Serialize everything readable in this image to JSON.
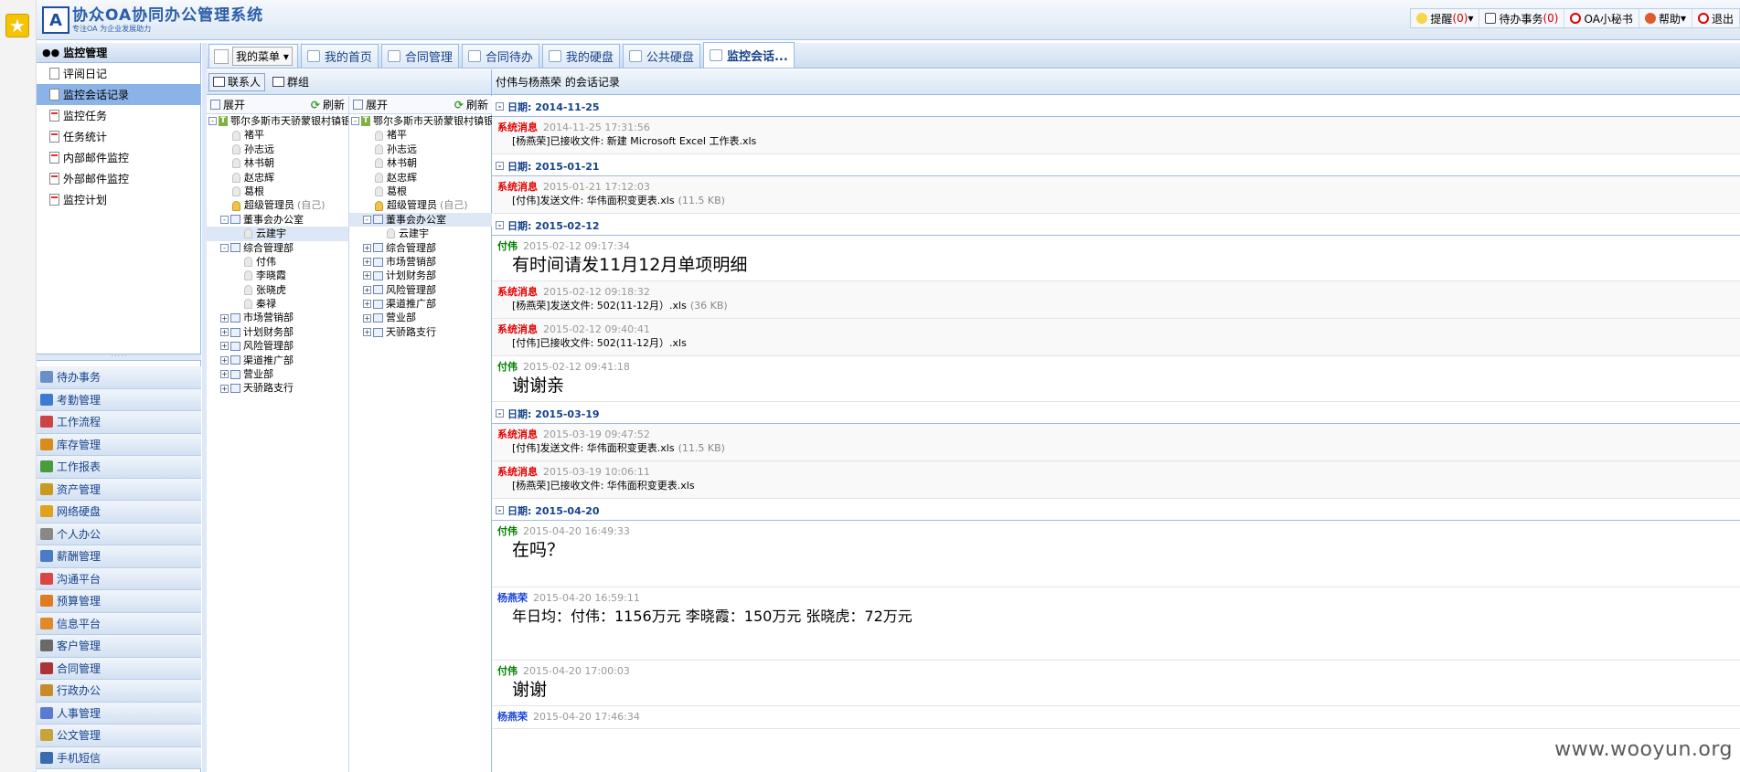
{
  "app": {
    "title": "协众OA协同办公管理系统",
    "slogan": "专注OA 为企业发展助力"
  },
  "topbar": {
    "items": [
      {
        "label": "提醒",
        "count": "(0)",
        "icon": "bulb-icon"
      },
      {
        "label": "待办事务",
        "count": "(0)",
        "icon": "todo-icon"
      },
      {
        "label": "OA小秘书",
        "icon": "clock-icon"
      },
      {
        "label": "帮助",
        "icon": "help-icon"
      },
      {
        "label": "退出",
        "icon": "power-icon"
      }
    ]
  },
  "sidebar": {
    "header": "监控管理",
    "items": [
      {
        "label": "评阅日记",
        "active": false
      },
      {
        "label": "监控会话记录",
        "active": true
      },
      {
        "label": "监控任务",
        "active": false
      },
      {
        "label": "任务统计",
        "active": false
      },
      {
        "label": "内部邮件监控",
        "active": false
      },
      {
        "label": "外部邮件监控",
        "active": false
      },
      {
        "label": "监控计划",
        "active": false
      }
    ],
    "modules": [
      "待办事务",
      "考勤管理",
      "工作流程",
      "库存管理",
      "工作报表",
      "资产管理",
      "网络硬盘",
      "个人办公",
      "薪酬管理",
      "沟通平台",
      "预算管理",
      "信息平台",
      "客户管理",
      "合同管理",
      "行政办公",
      "人事管理",
      "公文管理",
      "手机短信"
    ]
  },
  "tabs": {
    "menu_label": "我的菜单",
    "items": [
      {
        "label": "我的首页",
        "active": false
      },
      {
        "label": "合同管理",
        "active": false
      },
      {
        "label": "合同待办",
        "active": false
      },
      {
        "label": "我的硬盘",
        "active": false
      },
      {
        "label": "公共硬盘",
        "active": false
      },
      {
        "label": "监控会话...",
        "active": true
      }
    ]
  },
  "contacts": {
    "toolbar": {
      "contacts": "联系人",
      "groups": "群组"
    },
    "expand": "展开",
    "refresh": "刷新",
    "tree_left": [
      {
        "type": "root",
        "label": "鄂尔多斯市天骄蒙银村镇银行",
        "exp": "-",
        "indent": 0
      },
      {
        "type": "user",
        "label": "褚平",
        "indent": 2
      },
      {
        "type": "user",
        "label": "孙志远",
        "indent": 2
      },
      {
        "type": "user",
        "label": "林书朝",
        "indent": 2
      },
      {
        "type": "user",
        "label": "赵忠辉",
        "indent": 2
      },
      {
        "type": "user",
        "label": "葛根",
        "indent": 2
      },
      {
        "type": "admin",
        "label": "超级管理员",
        "note": "(自己)",
        "indent": 2
      },
      {
        "type": "dept",
        "label": "董事会办公室",
        "exp": "-",
        "indent": 1
      },
      {
        "type": "user",
        "label": "云建宇",
        "indent": 3,
        "sel": true
      },
      {
        "type": "dept",
        "label": "综合管理部",
        "exp": "-",
        "indent": 1
      },
      {
        "type": "user",
        "label": "付伟",
        "indent": 3
      },
      {
        "type": "user",
        "label": "李晓霞",
        "indent": 3
      },
      {
        "type": "user",
        "label": "张晓虎",
        "indent": 3
      },
      {
        "type": "user",
        "label": "秦禄",
        "indent": 3
      },
      {
        "type": "dept",
        "label": "市场营销部",
        "exp": "+",
        "indent": 1
      },
      {
        "type": "dept",
        "label": "计划财务部",
        "exp": "+",
        "indent": 1
      },
      {
        "type": "dept",
        "label": "风险管理部",
        "exp": "+",
        "indent": 1
      },
      {
        "type": "dept",
        "label": "渠道推广部",
        "exp": "+",
        "indent": 1
      },
      {
        "type": "dept",
        "label": "营业部",
        "exp": "+",
        "indent": 1
      },
      {
        "type": "dept",
        "label": "天骄路支行",
        "exp": "+",
        "indent": 1
      }
    ],
    "tree_right": [
      {
        "type": "root",
        "label": "鄂尔多斯市天骄蒙银村镇银行股",
        "exp": "-",
        "indent": 0
      },
      {
        "type": "user",
        "label": "褚平",
        "indent": 2
      },
      {
        "type": "user",
        "label": "孙志远",
        "indent": 2
      },
      {
        "type": "user",
        "label": "林书朝",
        "indent": 2
      },
      {
        "type": "user",
        "label": "赵忠辉",
        "indent": 2
      },
      {
        "type": "user",
        "label": "葛根",
        "indent": 2
      },
      {
        "type": "admin",
        "label": "超级管理员",
        "note": "(自己)",
        "indent": 2
      },
      {
        "type": "dept",
        "label": "董事会办公室",
        "exp": "-",
        "indent": 1,
        "sel": true
      },
      {
        "type": "user",
        "label": "云建宇",
        "indent": 3
      },
      {
        "type": "dept",
        "label": "综合管理部",
        "exp": "+",
        "indent": 1
      },
      {
        "type": "dept",
        "label": "市场营销部",
        "exp": "+",
        "indent": 1
      },
      {
        "type": "dept",
        "label": "计划财务部",
        "exp": "+",
        "indent": 1
      },
      {
        "type": "dept",
        "label": "风险管理部",
        "exp": "+",
        "indent": 1
      },
      {
        "type": "dept",
        "label": "渠道推广部",
        "exp": "+",
        "indent": 1
      },
      {
        "type": "dept",
        "label": "营业部",
        "exp": "+",
        "indent": 1
      },
      {
        "type": "dept",
        "label": "天骄路支行",
        "exp": "+",
        "indent": 1
      }
    ]
  },
  "chat": {
    "title": "付伟与杨燕荣  的会话记录",
    "days": [
      {
        "date": "日期: 2014-11-25",
        "msgs": [
          {
            "sender": "系统消息",
            "kind": "sys",
            "time": "2014-11-25 17:31:56",
            "text": "[杨燕荣]已接收文件: 新建  Microsoft Excel 工作表.xls",
            "size": "",
            "style": "small"
          }
        ]
      },
      {
        "date": "日期: 2015-01-21",
        "msgs": [
          {
            "sender": "系统消息",
            "kind": "sys",
            "time": "2015-01-21 17:12:03",
            "text": "[付伟]发送文件: 华伟面积变更表.xls",
            "size": "(11.5 KB)",
            "style": "small"
          }
        ]
      },
      {
        "date": "日期: 2015-02-12",
        "msgs": [
          {
            "sender": "付伟",
            "kind": "fw",
            "time": "2015-02-12 09:17:34",
            "text": "有时间请发11月12月单项明细",
            "size": "",
            "style": "big"
          },
          {
            "sender": "系统消息",
            "kind": "sys",
            "time": "2015-02-12 09:18:32",
            "text": "[杨燕荣]发送文件: 502(11-12月）.xls",
            "size": "(36 KB)",
            "style": "small"
          },
          {
            "sender": "系统消息",
            "kind": "sys",
            "time": "2015-02-12 09:40:41",
            "text": "[付伟]已接收文件: 502(11-12月）.xls",
            "size": "",
            "style": "small"
          },
          {
            "sender": "付伟",
            "kind": "fw",
            "time": "2015-02-12 09:41:18",
            "text": "谢谢亲",
            "size": "",
            "style": "big"
          }
        ]
      },
      {
        "date": "日期: 2015-03-19",
        "msgs": [
          {
            "sender": "系统消息",
            "kind": "sys",
            "time": "2015-03-19 09:47:52",
            "text": "[付伟]发送文件: 华伟面积变更表.xls",
            "size": "(11.5 KB)",
            "style": "small"
          },
          {
            "sender": "系统消息",
            "kind": "sys",
            "time": "2015-03-19 10:06:11",
            "text": "[杨燕荣]已接收文件: 华伟面积变更表.xls",
            "size": "",
            "style": "small"
          }
        ]
      },
      {
        "date": "日期: 2015-04-20",
        "msgs": [
          {
            "sender": "付伟",
            "kind": "fw",
            "time": "2015-04-20 16:49:33",
            "text": "在吗？",
            "size": "",
            "style": "big",
            "pad": 28
          },
          {
            "sender": "杨燕荣",
            "kind": "yhr",
            "time": "2015-04-20 16:59:11",
            "text": "年日均：付伟：1156万元    李晓霞：150万元    张晓虎：72万元",
            "size": "",
            "style": "mid",
            "pad": 36
          },
          {
            "sender": "付伟",
            "kind": "fw",
            "time": "2015-04-20 17:00:03",
            "text": "谢谢",
            "size": "",
            "style": "big"
          },
          {
            "sender": "杨燕荣",
            "kind": "yhr",
            "time": "2015-04-20 17:46:34",
            "text": "",
            "size": "",
            "style": "small"
          }
        ]
      }
    ]
  },
  "watermark": "www.wooyun.org",
  "colors": {
    "accent": "#15428b",
    "system_msg": "#e40000",
    "fuwei": "#008000",
    "yangyanrong": "#1a44d9",
    "active_nav": "#8cb3e8"
  }
}
